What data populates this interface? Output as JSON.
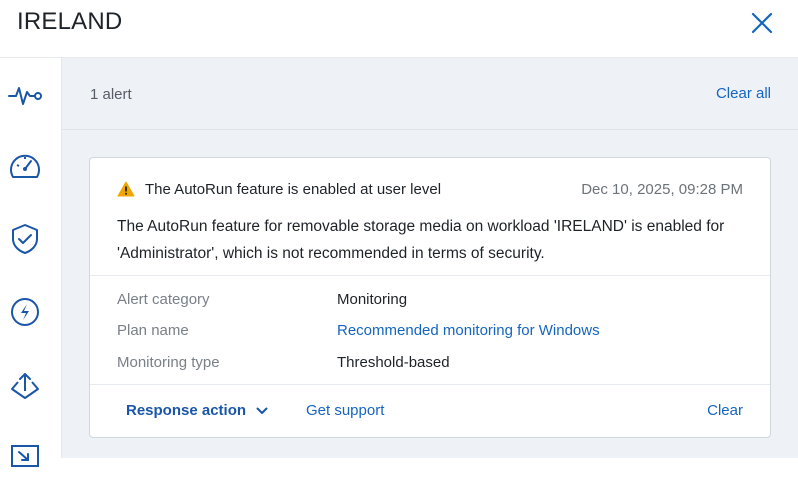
{
  "header": {
    "title": "IRELAND"
  },
  "sidebar": {
    "items": [
      {
        "icon": "activity-icon"
      },
      {
        "icon": "dashboard-gauge-icon"
      },
      {
        "icon": "shield-check-icon"
      },
      {
        "icon": "lightning-icon"
      },
      {
        "icon": "deploy-icon"
      },
      {
        "icon": "remote-desktop-icon"
      }
    ]
  },
  "main": {
    "alert_count": "1 alert",
    "clear_all_label": "Clear all"
  },
  "alert": {
    "title": "The AutoRun feature is enabled at user level",
    "date": "Dec 10, 2025, 09:28 PM",
    "description": "The AutoRun feature for removable storage media on workload 'IRELAND' is enabled for 'Administrator', which is not recommended in terms of security.",
    "details": [
      {
        "label": "Alert category",
        "value": "Monitoring"
      },
      {
        "label": "Plan name",
        "value": "Recommended monitoring for Windows"
      },
      {
        "label": "Monitoring type",
        "value": "Threshold-based"
      }
    ],
    "actions": {
      "response_action": "Response action",
      "get_support": "Get support",
      "clear": "Clear"
    }
  },
  "colors": {
    "accent": "#1565c0",
    "warning": "#f0a500",
    "background": "#eef2f7"
  }
}
